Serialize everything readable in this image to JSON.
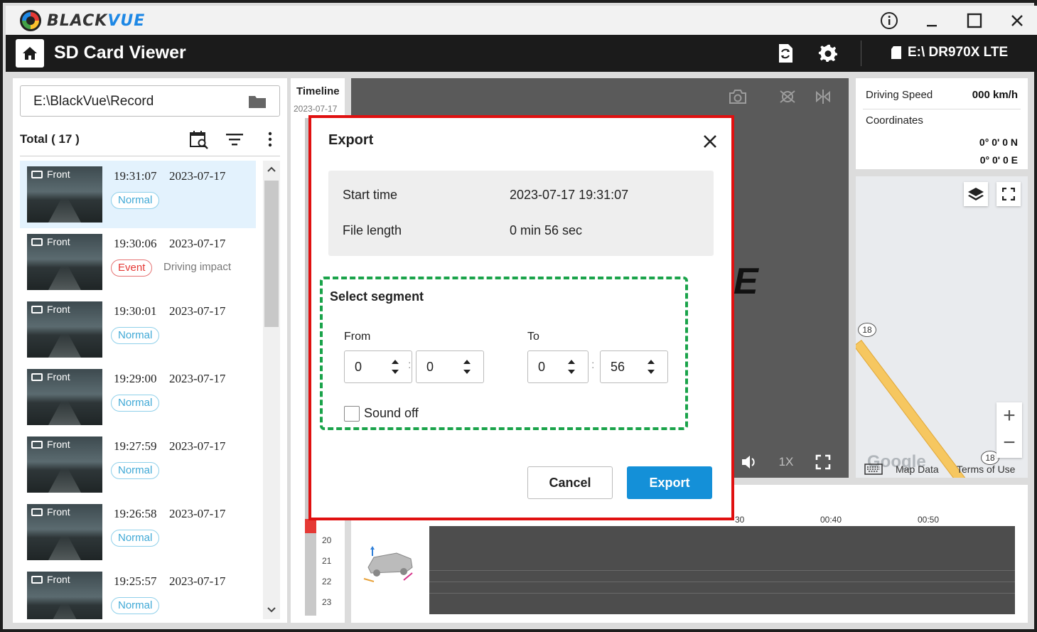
{
  "app": {
    "brand_prefix": "BLACK",
    "brand_suffix": "VUE",
    "title": "SD Card Viewer",
    "device": "E:\\ DR970X LTE"
  },
  "window_controls": [
    "info-icon",
    "minimize-icon",
    "maximize-icon",
    "close-icon"
  ],
  "header_icons": [
    "sd-sync-icon",
    "settings-icon",
    "sd-card-icon"
  ],
  "left": {
    "path": "E:\\BlackVue\\Record",
    "total": "Total ( 17 )",
    "recordings": [
      {
        "camera": "Front",
        "time": "19:31:07",
        "date": "2023-07-17",
        "type": "Normal",
        "note": "",
        "selected": true
      },
      {
        "camera": "Front",
        "time": "19:30:06",
        "date": "2023-07-17",
        "type": "Event",
        "note": "Driving impact",
        "selected": false
      },
      {
        "camera": "Front",
        "time": "19:30:01",
        "date": "2023-07-17",
        "type": "Normal",
        "note": "",
        "selected": false
      },
      {
        "camera": "Front",
        "time": "19:29:00",
        "date": "2023-07-17",
        "type": "Normal",
        "note": "",
        "selected": false
      },
      {
        "camera": "Front",
        "time": "19:27:59",
        "date": "2023-07-17",
        "type": "Normal",
        "note": "",
        "selected": false
      },
      {
        "camera": "Front",
        "time": "19:26:58",
        "date": "2023-07-17",
        "type": "Normal",
        "note": "",
        "selected": false
      },
      {
        "camera": "Front",
        "time": "19:25:57",
        "date": "2023-07-17",
        "type": "Normal",
        "note": "",
        "selected": false
      }
    ]
  },
  "timeline": {
    "title": "Timeline",
    "date": "2023-07-17",
    "hours": [
      "20",
      "21",
      "22",
      "23"
    ]
  },
  "video": {
    "logo_fragment": "E",
    "speed": "1X"
  },
  "info": {
    "speed_label": "Driving Speed",
    "speed_value": "000 km/h",
    "coord_label": "Coordinates",
    "lat": "0° 0'   0 N",
    "lon": "0° 0'   0 E"
  },
  "map": {
    "route_number": "18",
    "map_data": "Map Data",
    "terms": "Terms of Use",
    "google": "Google"
  },
  "graph": {
    "ticks": [
      "30",
      "00:40",
      "00:50"
    ]
  },
  "modal": {
    "title": "Export",
    "start_label": "Start time",
    "start_value": "2023-07-17 19:31:07",
    "length_label": "File length",
    "length_value": "0 min 56 sec",
    "segment_title": "Select segment",
    "from_label": "From",
    "to_label": "To",
    "from_min": "0",
    "from_sec": "0",
    "to_min": "0",
    "to_sec": "56",
    "sound_off_label": "Sound off",
    "sound_off_checked": false,
    "cancel_label": "Cancel",
    "export_label": "Export"
  },
  "colors": {
    "accent": "#1490d8",
    "highlight_border": "#e01010",
    "segment_border": "#1aa34a",
    "selected_row": "#e3f2fd",
    "event": "#e53935"
  }
}
